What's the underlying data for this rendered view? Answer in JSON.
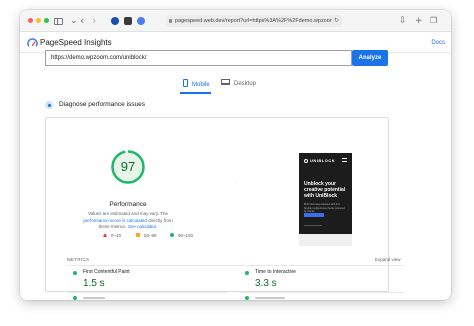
{
  "browser": {
    "address": "pagespeed.web.dev/report?url=https%3A%2F%2Fdemo.wpzoom.co",
    "reload_icon": "reload-icon"
  },
  "header": {
    "title": "PageSpeed Insights",
    "docs_label": "Docs"
  },
  "form": {
    "url_value": "https://demo.wpzoom.com/uniblock/",
    "analyze_label": "Analyze"
  },
  "tabs": [
    {
      "label": "Mobile",
      "active": true,
      "icon": "mobile-icon"
    },
    {
      "label": "Desktop",
      "active": false,
      "icon": "desktop-icon"
    }
  ],
  "diagnose": {
    "title": "Diagnose performance issues"
  },
  "performance": {
    "score": "97",
    "score_fraction": 0.97,
    "label": "Performance",
    "note_prefix": "Values are estimated and may vary. The ",
    "note_link1": "performance score is calculated",
    "note_mid": " directly from these metrics. ",
    "note_link2": "See calculator.",
    "legend": [
      {
        "range": "0–49",
        "marker": "triangle",
        "color": "#e53935"
      },
      {
        "range": "50–89",
        "marker": "square",
        "color": "#f9a825"
      },
      {
        "range": "90–100",
        "marker": "circle",
        "color": "#1fb86a"
      }
    ],
    "colors": {
      "pass": "#1fb86a",
      "pass_text": "#0c6b2c",
      "track": "#e6f4ea"
    }
  },
  "preview": {
    "brand": "UNIBLOCK",
    "headline": "Unblock your creative potential with UniBlock",
    "body": "Build stunning websites with this flexible multipurpose theme powered by blocks."
  },
  "metrics": {
    "header": "METRICS",
    "expand_label": "Expand view",
    "items": [
      {
        "name": "First Contentful Paint",
        "value": "1.5 s",
        "status": "pass"
      },
      {
        "name": "Time to Interactive",
        "value": "3.3 s",
        "status": "pass"
      }
    ]
  },
  "accent": "#1a73e8"
}
